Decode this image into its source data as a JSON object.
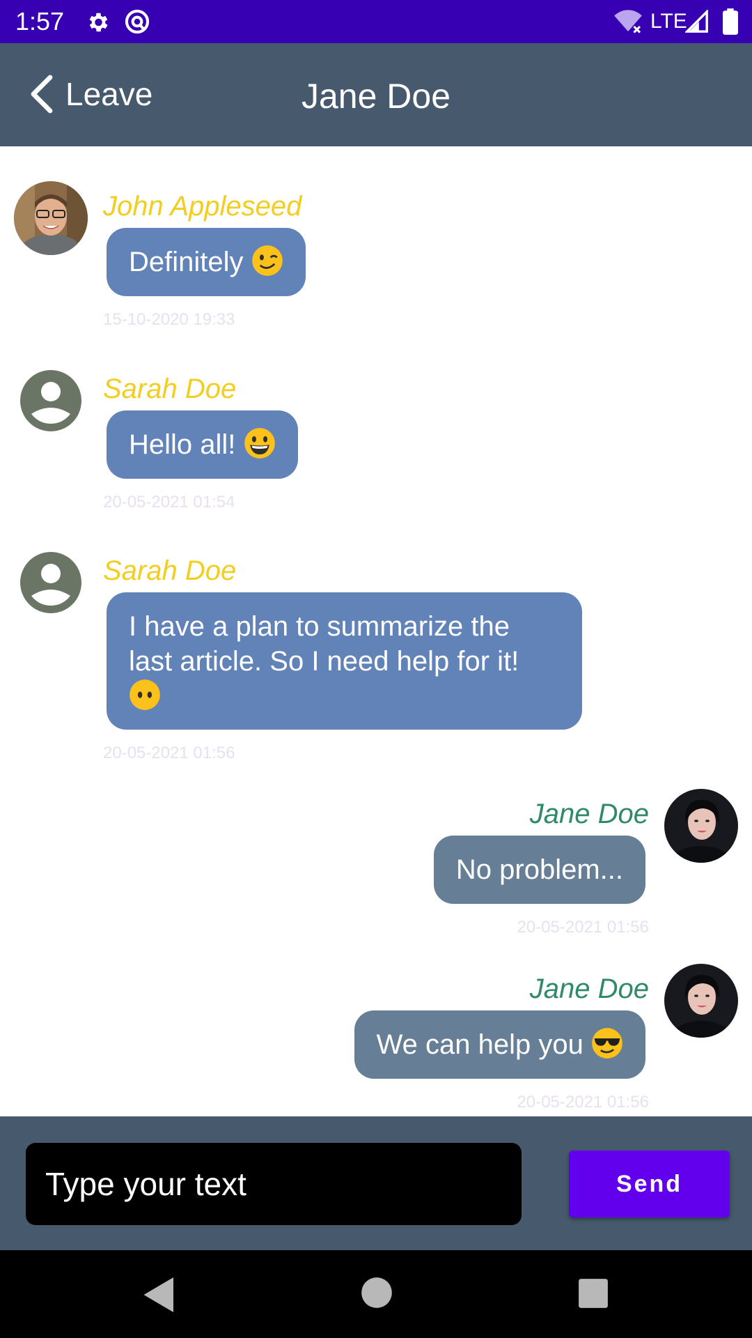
{
  "status_bar": {
    "time": "1:57",
    "network": "LTE"
  },
  "header": {
    "back_label": "Leave",
    "title": "Jane Doe"
  },
  "messages": [
    {
      "sender": "John Appleseed",
      "text": "Definitely",
      "emoji": "wink-emoji",
      "timestamp": "15-10-2020 19:33",
      "direction": "incoming",
      "avatar": "photo-man-avatar"
    },
    {
      "sender": "Sarah Doe",
      "text": "Hello all!",
      "emoji": "grin-emoji",
      "timestamp": "20-05-2021 01:54",
      "direction": "incoming",
      "avatar": "default-user-avatar"
    },
    {
      "sender": "Sarah Doe",
      "text": "I have a plan to summarize the last article. So I need help for it!",
      "emoji": "no-mouth-emoji",
      "timestamp": "20-05-2021 01:56",
      "direction": "incoming",
      "avatar": "default-user-avatar"
    },
    {
      "sender": "Jane Doe",
      "text": "No problem...",
      "emoji": "",
      "timestamp": "20-05-2021 01:56",
      "direction": "outgoing",
      "avatar": "photo-woman-avatar"
    },
    {
      "sender": "Jane Doe",
      "text": "We can help you",
      "emoji": "sunglasses-emoji",
      "timestamp": "20-05-2021 01:56",
      "direction": "outgoing",
      "avatar": "photo-woman-avatar"
    }
  ],
  "composer": {
    "placeholder": "Type your text",
    "send_label": "Send"
  },
  "colors": {
    "status_bar": "#3700b3",
    "header": "#475a6d",
    "incoming_bubble": "#6283b8",
    "outgoing_bubble": "#667f96",
    "incoming_sender": "#f3cd1f",
    "outgoing_sender": "#2f8a67",
    "send_button": "#6200ee"
  }
}
